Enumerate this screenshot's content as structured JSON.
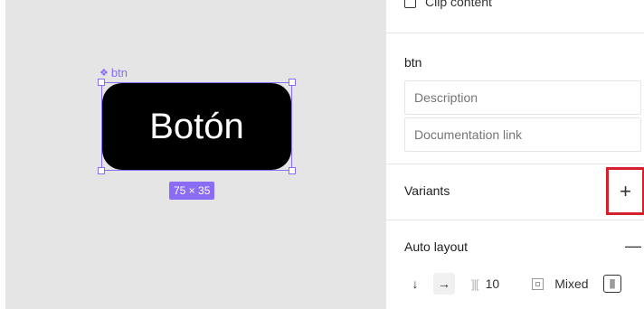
{
  "canvas": {
    "component_label": "btn",
    "button_text": "Botón",
    "size_badge": "75 × 35"
  },
  "panel": {
    "clip_content_label": "Clip content",
    "component_name": "btn",
    "description_placeholder": "Description",
    "documentation_placeholder": "Documentation link",
    "variants_label": "Variants",
    "variants_add_symbol": "+",
    "auto_layout_label": "Auto layout",
    "auto_layout_remove_symbol": "—",
    "direction_vertical_symbol": "↓",
    "direction_horizontal_symbol": "→",
    "gap_value": "10",
    "padding_value": "Mixed"
  },
  "colors": {
    "selection": "#8b6cf5",
    "highlight": "#d3202a"
  }
}
